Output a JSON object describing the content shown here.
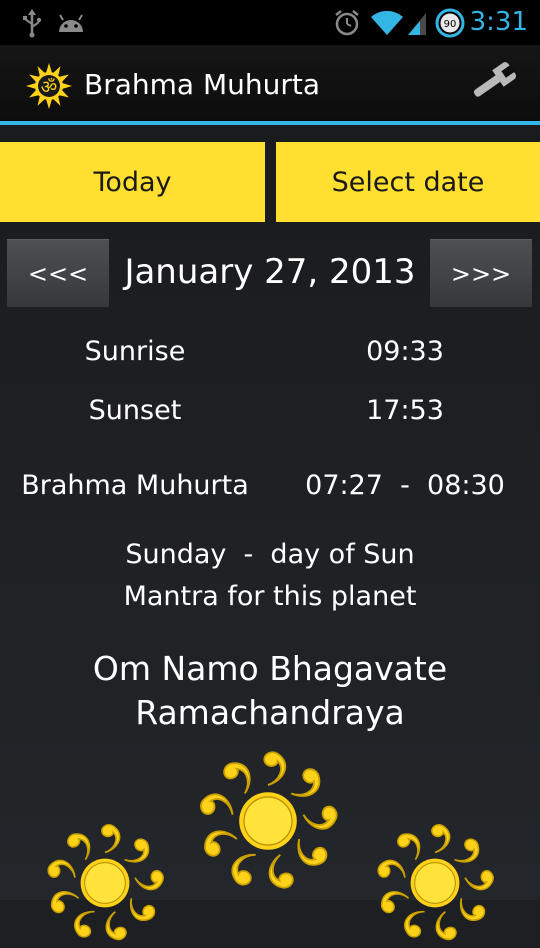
{
  "status_bar": {
    "time": "3:31",
    "battery_level": "90",
    "icons": [
      "usb-icon",
      "android-debug-icon",
      "alarm-icon",
      "wifi-icon",
      "signal-icon",
      "battery-icon"
    ],
    "time_color": "#33b5e5"
  },
  "action_bar": {
    "title": "Brahma Muhurta",
    "logo_icon": "om-sun-icon",
    "settings_icon": "wrench-icon",
    "accent": "#33b5e5"
  },
  "buttons": {
    "today": "Today",
    "select_date": "Select date",
    "prev": "<<<",
    "next": ">>>",
    "color": "#ffdf2f"
  },
  "date": "January 27, 2013",
  "times": {
    "sunrise_label": "Sunrise",
    "sunrise": "09:33",
    "sunset_label": "Sunset",
    "sunset": "17:53",
    "brahma_label": "Brahma Muhurta",
    "brahma_range": "07:27  -  08:30"
  },
  "planet": {
    "day_line": "Sunday  -  day of Sun",
    "caption": "Mantra for this planet",
    "mantra_line1": "Om Namo Bhagavate",
    "mantra_line2": "Ramachandraya"
  },
  "decorations": [
    "sun-icon",
    "sun-icon",
    "sun-icon"
  ]
}
